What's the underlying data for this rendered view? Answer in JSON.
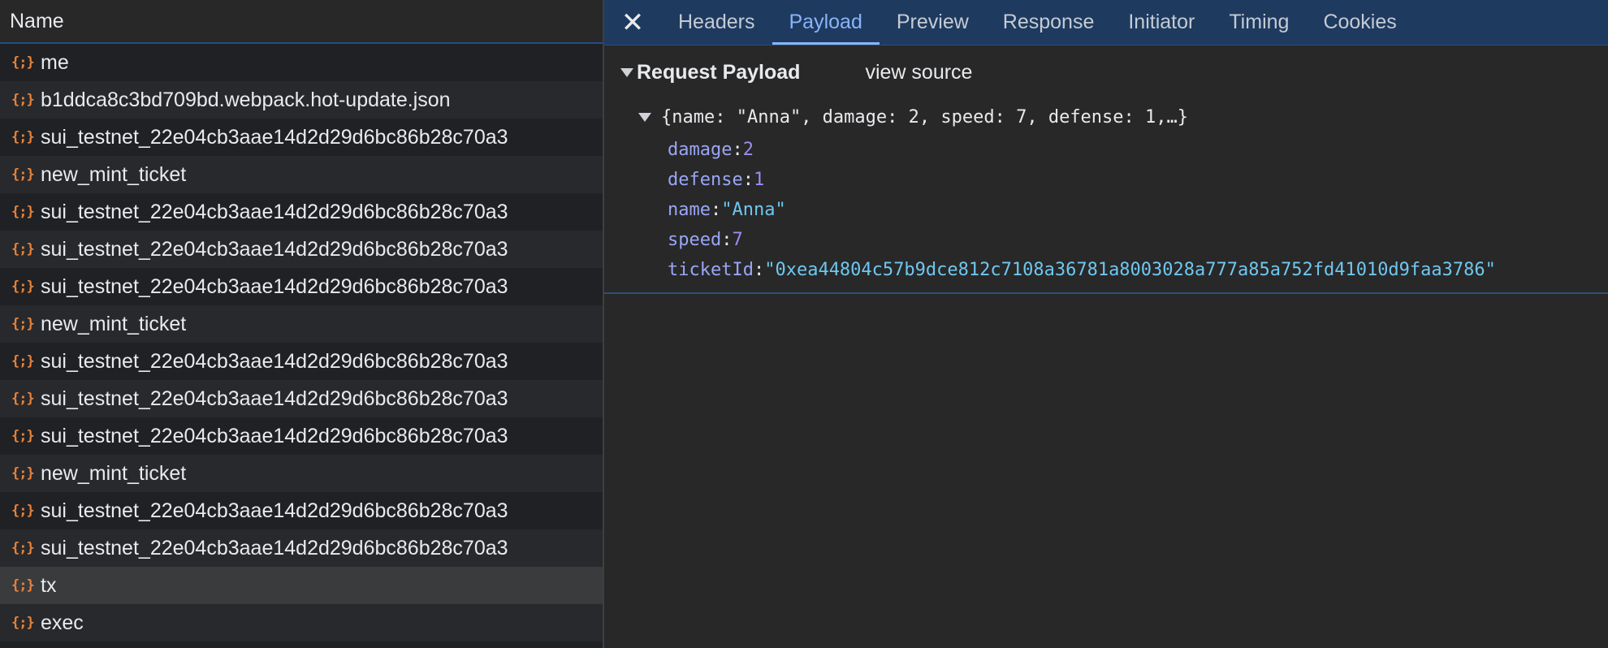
{
  "left": {
    "header": "Name",
    "icon_glyph": "{;}",
    "rows": [
      {
        "label": "me"
      },
      {
        "label": "b1ddca8c3bd709bd.webpack.hot-update.json"
      },
      {
        "label": "sui_testnet_22e04cb3aae14d2d29d6bc86b28c70a3"
      },
      {
        "label": "new_mint_ticket"
      },
      {
        "label": "sui_testnet_22e04cb3aae14d2d29d6bc86b28c70a3"
      },
      {
        "label": "sui_testnet_22e04cb3aae14d2d29d6bc86b28c70a3"
      },
      {
        "label": "sui_testnet_22e04cb3aae14d2d29d6bc86b28c70a3"
      },
      {
        "label": "new_mint_ticket"
      },
      {
        "label": "sui_testnet_22e04cb3aae14d2d29d6bc86b28c70a3"
      },
      {
        "label": "sui_testnet_22e04cb3aae14d2d29d6bc86b28c70a3"
      },
      {
        "label": "sui_testnet_22e04cb3aae14d2d29d6bc86b28c70a3"
      },
      {
        "label": "new_mint_ticket"
      },
      {
        "label": "sui_testnet_22e04cb3aae14d2d29d6bc86b28c70a3"
      },
      {
        "label": "sui_testnet_22e04cb3aae14d2d29d6bc86b28c70a3"
      },
      {
        "label": "tx",
        "selected": true
      },
      {
        "label": "exec"
      }
    ]
  },
  "right": {
    "close_glyph": "✕",
    "tabs": [
      {
        "label": "Headers"
      },
      {
        "label": "Payload",
        "active": true
      },
      {
        "label": "Preview"
      },
      {
        "label": "Response"
      },
      {
        "label": "Initiator"
      },
      {
        "label": "Timing"
      },
      {
        "label": "Cookies"
      }
    ],
    "payload": {
      "title": "Request Payload",
      "view_source": "view source",
      "summary": "{name: \"Anna\", damage: 2, speed: 7, defense: 1,…}",
      "properties": [
        {
          "key": "damage",
          "value": "2",
          "kind": "num"
        },
        {
          "key": "defense",
          "value": "1",
          "kind": "num"
        },
        {
          "key": "name",
          "value": "\"Anna\"",
          "kind": "str"
        },
        {
          "key": "speed",
          "value": "7",
          "kind": "num"
        },
        {
          "key": "ticketId",
          "value": "\"0xea44804c57b9dce812c7108a36781a8003028a777a85a752fd41010d9faa3786\"",
          "kind": "str"
        }
      ]
    }
  },
  "colors": {
    "icon": "#e8833a",
    "active_tab": "#8ab4f8",
    "tab_bar": "#1e3a5f"
  }
}
